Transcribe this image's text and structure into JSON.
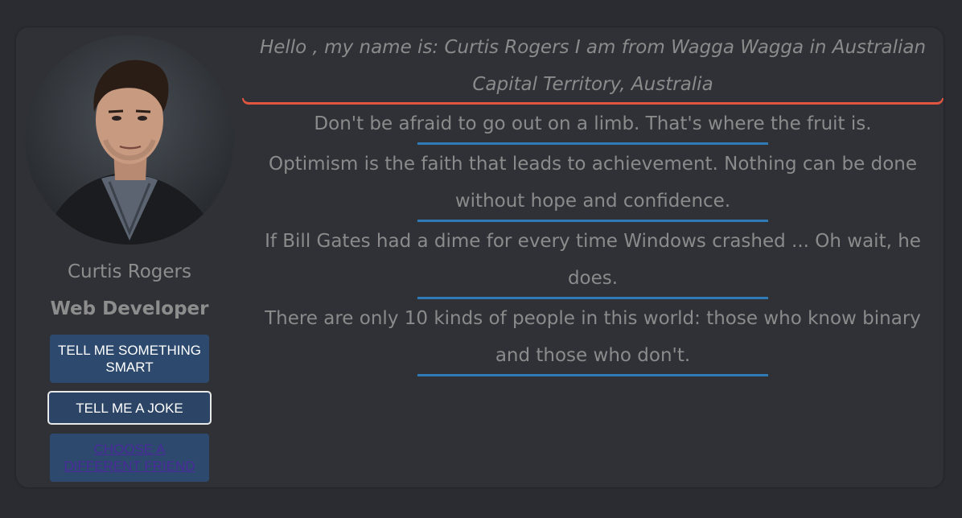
{
  "profile": {
    "name": "Curtis Rogers",
    "role": "Web Developer"
  },
  "buttons": {
    "smart_label": "TELL ME SOMETHING SMART",
    "joke_label": "TELL ME A JOKE",
    "friend_label": "CHOOSE A DIFFERENT FRIEND"
  },
  "greeting": "Hello , my name is: Curtis Rogers I am from Wagga Wagga in Australian Capital Territory, Australia",
  "quotes": [
    "Don't be afraid to go out on a limb. That's where the fruit is.",
    "Optimism is the faith that leads to achievement. Nothing can be done without hope and confidence.",
    "If Bill Gates had a dime for every time Windows crashed ... Oh wait, he does.",
    "There are only 10 kinds of people in this world: those who know binary and those who don't."
  ],
  "colors": {
    "background": "#2b2c31",
    "card": "#303137",
    "greeting_accent": "#e0553f",
    "quote_accent": "#2e7bb5",
    "button": "#2d4a6e",
    "link": "#4a2a9b"
  }
}
